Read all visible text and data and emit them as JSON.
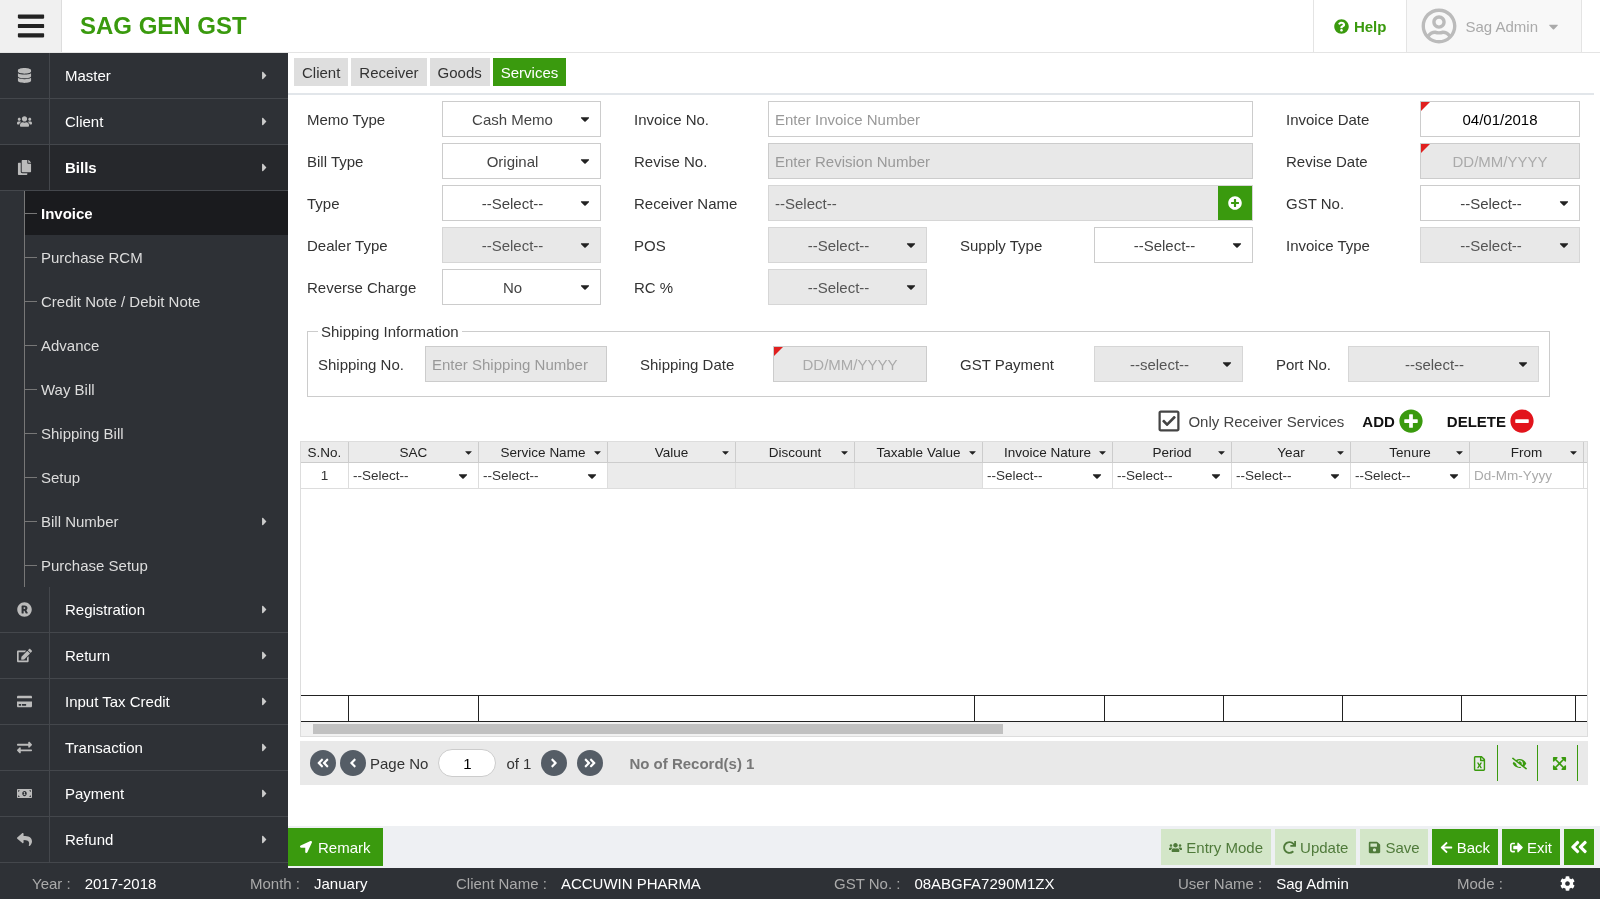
{
  "header": {
    "title": "SAG GEN GST",
    "help": "Help",
    "user": "Sag Admin"
  },
  "sidebar": {
    "items": [
      {
        "label": "Master",
        "has_submenu": true,
        "selected": false
      },
      {
        "label": "Client",
        "has_submenu": true,
        "selected": false
      },
      {
        "label": "Bills",
        "has_submenu": true,
        "selected": true,
        "children": [
          {
            "label": "Invoice",
            "has_submenu": false,
            "selected": true
          },
          {
            "label": "Purchase RCM",
            "has_submenu": false,
            "selected": false
          },
          {
            "label": "Credit Note / Debit Note",
            "has_submenu": false,
            "selected": false
          },
          {
            "label": "Advance",
            "has_submenu": false,
            "selected": false
          },
          {
            "label": "Way Bill",
            "has_submenu": false,
            "selected": false
          },
          {
            "label": "Shipping Bill",
            "has_submenu": false,
            "selected": false
          },
          {
            "label": "Setup",
            "has_submenu": false,
            "selected": false
          },
          {
            "label": "Bill Number",
            "has_submenu": true,
            "selected": false
          },
          {
            "label": "Purchase Setup",
            "has_submenu": false,
            "selected": false
          }
        ]
      },
      {
        "label": "Registration",
        "has_submenu": true,
        "selected": false
      },
      {
        "label": "Return",
        "has_submenu": true,
        "selected": false
      },
      {
        "label": "Input Tax Credit",
        "has_submenu": true,
        "selected": false
      },
      {
        "label": "Transaction",
        "has_submenu": true,
        "selected": false
      },
      {
        "label": "Payment",
        "has_submenu": true,
        "selected": false
      },
      {
        "label": "Refund",
        "has_submenu": true,
        "selected": false
      }
    ]
  },
  "tabs": [
    {
      "label": "Client",
      "selected": false
    },
    {
      "label": "Receiver",
      "selected": false
    },
    {
      "label": "Goods",
      "selected": false
    },
    {
      "label": "Services",
      "selected": true
    }
  ],
  "form": {
    "rows": [
      [
        {
          "label": "Memo Type",
          "kind": "select",
          "value": "Cash Memo",
          "disabled": false
        },
        {
          "label": "Invoice No.",
          "kind": "wide_input",
          "placeholder": "Enter Invoice Number",
          "disabled": false
        },
        {
          "label": "Invoice Date",
          "kind": "date",
          "value": "04/01/2018",
          "disabled": false
        }
      ],
      [
        {
          "label": "Bill Type",
          "kind": "select",
          "value": "Original",
          "disabled": false
        },
        {
          "label": "Revise No.",
          "kind": "wide_input",
          "placeholder": "Enter Revision Number",
          "disabled": true
        },
        {
          "label": "Revise Date",
          "kind": "date",
          "placeholder": "DD/MM/YYYY",
          "disabled": true
        }
      ],
      [
        {
          "label": "Type",
          "kind": "select",
          "value": "--Select--",
          "disabled": false
        },
        {
          "label": "Receiver Name",
          "kind": "wide_lookup",
          "value": "--Select--",
          "disabled": true
        },
        {
          "label": "GST No.",
          "kind": "select",
          "value": "--Select--",
          "disabled": false
        }
      ],
      [
        {
          "label": "Dealer Type",
          "kind": "select",
          "value": "--Select--",
          "disabled": true
        },
        {
          "label": "POS",
          "kind": "select",
          "value": "--Select--",
          "disabled": true
        },
        {
          "label": "Supply Type",
          "kind": "select",
          "value": "--Select--",
          "disabled": false
        },
        {
          "label": "Invoice Type",
          "kind": "select",
          "value": "--Select--",
          "disabled": true
        }
      ],
      [
        {
          "label": "Reverse Charge",
          "kind": "select",
          "value": "No",
          "disabled": false
        },
        {
          "label": "RC %",
          "kind": "select",
          "value": "--Select--",
          "disabled": true
        }
      ]
    ]
  },
  "shipping": {
    "legend": "Shipping Information",
    "fields": [
      {
        "label": "Shipping No.",
        "kind": "input",
        "placeholder": "Enter Shipping Number",
        "disabled": true
      },
      {
        "label": "Shipping Date",
        "kind": "date",
        "placeholder": "DD/MM/YYYY",
        "disabled": true
      },
      {
        "label": "GST Payment",
        "kind": "select",
        "value": "--select--",
        "disabled": true
      },
      {
        "label": "Port No.",
        "kind": "select",
        "value": "--select--",
        "disabled": true
      }
    ]
  },
  "toolbar": {
    "only_receiver": {
      "label": "Only Receiver Services",
      "checked": true
    },
    "add": "ADD",
    "delete": "DELETE"
  },
  "table": {
    "columns": [
      "S.No.",
      "SAC",
      "Service Name",
      "Value",
      "Discount",
      "Taxable Value",
      "Invoice Nature",
      "Period",
      "Year",
      "Tenure",
      "From"
    ],
    "rows": [
      {
        "cells": [
          {
            "kind": "text",
            "text": "1"
          },
          {
            "kind": "select",
            "text": "--Select--"
          },
          {
            "kind": "select",
            "text": "--Select--"
          },
          {
            "kind": "blank"
          },
          {
            "kind": "blank"
          },
          {
            "kind": "blank"
          },
          {
            "kind": "select",
            "text": "--Select--"
          },
          {
            "kind": "select",
            "text": "--Select--"
          },
          {
            "kind": "select",
            "text": "--Select--"
          },
          {
            "kind": "select",
            "text": "--Select--"
          },
          {
            "kind": "date",
            "placeholder": "Dd-Mm-Yyyy"
          }
        ]
      }
    ]
  },
  "pager": {
    "label": "Page No",
    "page": "1",
    "of": "of 1",
    "records": "No of Record(s) 1"
  },
  "actions": {
    "remark": "Remark",
    "buttons": [
      {
        "kind": "entry",
        "label": "Entry Mode",
        "disabled": true
      },
      {
        "kind": "update",
        "label": "Update",
        "disabled": true
      },
      {
        "kind": "save",
        "label": "Save",
        "disabled": true
      },
      {
        "kind": "back",
        "label": "Back",
        "disabled": false
      },
      {
        "kind": "exit",
        "label": "Exit",
        "disabled": false
      }
    ]
  },
  "status_bar": [
    {
      "label": "Year :",
      "value": "2017-2018"
    },
    {
      "label": "Month :",
      "value": "January"
    },
    {
      "label": "Client Name :",
      "value": "ACCUWIN PHARMA"
    },
    {
      "label": "GST No. :",
      "value": "08ABGFA7290M1ZX"
    },
    {
      "label": "User Name :",
      "value": "Sag Admin"
    },
    {
      "label": "Mode :"
    }
  ]
}
